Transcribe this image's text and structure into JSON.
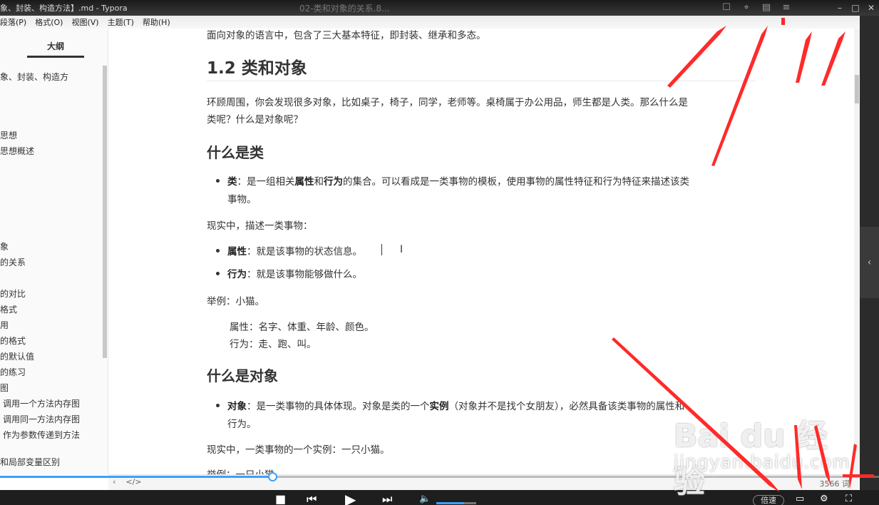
{
  "window": {
    "doc_title": "象、封装、构造方法】.md - Typora",
    "video_title": "02-类和对象的关系.8...",
    "title_icons": [
      "square-icon",
      "pin-icon",
      "folder-icon",
      "list-icon"
    ],
    "controls": {
      "minimize": "–",
      "maximize": "□",
      "close": "✕"
    }
  },
  "menu": [
    "段落(P)",
    "格式(O)",
    "视图(V)",
    "主题(T)",
    "帮助(H)"
  ],
  "sidebar": {
    "tab_label": "大纲",
    "items": [
      "象、封装、构造方",
      "思想",
      "思想概述",
      "象",
      "的关系",
      "的对比",
      "格式",
      "用",
      "的格式",
      "的默认值",
      "的练习",
      "图",
      "调用一个方法内存图",
      "调用同一方法内存图",
      "作为参数传递到方法",
      "和局部变量区别"
    ]
  },
  "content": {
    "intro": "面向对象的语言中，包含了三大基本特征，即封装、继承和多态。",
    "h2": "1.2 类和对象",
    "p1_line1": "环顾周围，你会发现很多对象，比如桌子，椅子，同学，老师等。桌椅属于办公用品，师生都是人类。那么什么是",
    "p1_line2": "类呢？什么是对象呢？",
    "h3_class": "什么是类",
    "class_def": {
      "term": "类",
      "part1": "：是一组相关",
      "bold1": "属性",
      "part2": "和",
      "bold2": "行为",
      "part3": "的集合。可以看成是一类事物的模板，使用事物的属性特征和行为特征来描述该类",
      "line2": "事物。"
    },
    "reality1": "现实中，描述一类事物：",
    "attr": {
      "term": "属性",
      "desc": "：就是该事物的状态信息。"
    },
    "behav": {
      "term": "行为",
      "desc": "：就是该事物能够做什么。"
    },
    "example1": "举例：小猫。",
    "example1_attr": "属性：名字、体重、年龄、颜色。",
    "example1_behav": "行为：走、跑、叫。",
    "h3_object": "什么是对象",
    "obj_def": {
      "term": "对象",
      "part1": "：是一类事物的具体体现。对象是类的一个",
      "bold1": "实例",
      "part2": "（对象并不是找个女朋友），必然具备该类事物的属性和",
      "line2": "行为。"
    },
    "reality2": "现实中，一类事物的一个实例：一只小猫。",
    "example2": "举例：一只小猫。"
  },
  "statusbar": {
    "icons": [
      "chevron-left-icon",
      "code-icon"
    ],
    "left_glyphs": [
      "‹",
      "</>"
    ],
    "word_count": "3566 词"
  },
  "player": {
    "progress": 0.31,
    "volume": 0.7,
    "speed_label": "倍速",
    "glyphs": {
      "stop": "■",
      "prev": "⏮",
      "play": "▶",
      "next": "⏭",
      "volume": "🔈",
      "settings": "⚙",
      "fullscreen": "⛶",
      "screen": "▭"
    }
  },
  "watermark": {
    "logo": "Bai du 经验",
    "sub": "jingyan.baidu.com"
  },
  "colors": {
    "accent": "#3aa0ff",
    "annotation": "#ff2a2a"
  }
}
